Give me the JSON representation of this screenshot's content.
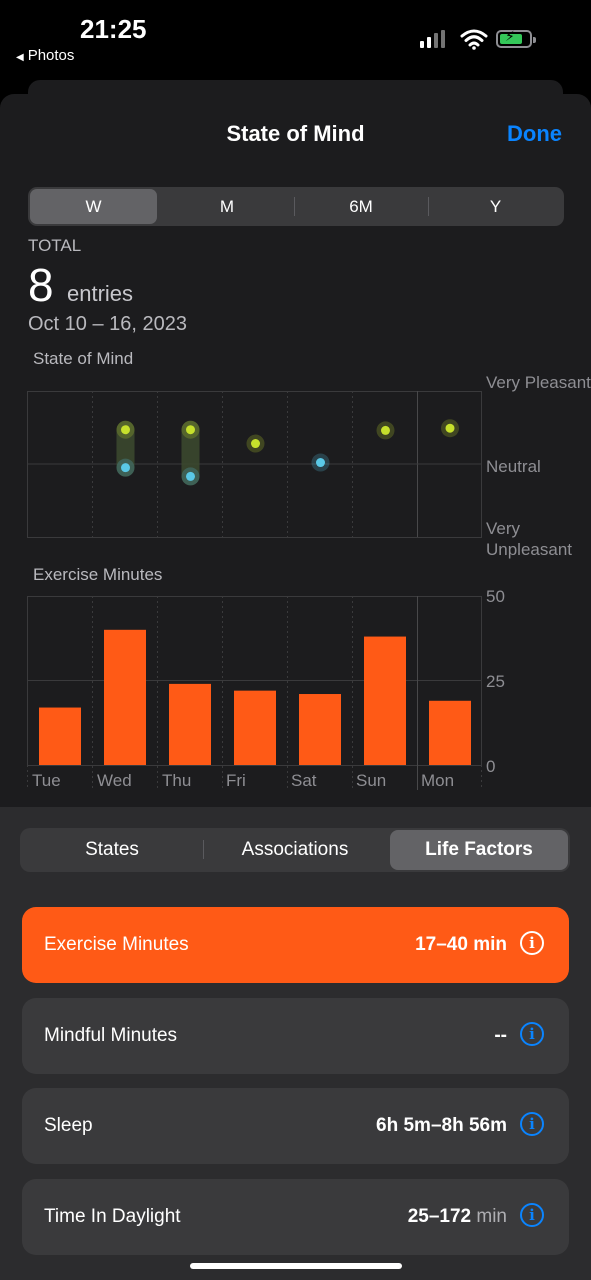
{
  "status": {
    "time": "21:25",
    "back_label": "Photos"
  },
  "header": {
    "title": "State of Mind",
    "done_label": "Done"
  },
  "periods": [
    {
      "label": "W",
      "selected": true
    },
    {
      "label": "M",
      "selected": false
    },
    {
      "label": "6M",
      "selected": false
    },
    {
      "label": "Y",
      "selected": false
    }
  ],
  "summary": {
    "label": "TOTAL",
    "count": "8",
    "unit": "entries",
    "range": "Oct 10 – 16, 2023"
  },
  "colors": {
    "accent": "#0a84ff",
    "exercise": "#ff5a16",
    "pleasant": "#c6e02c",
    "neutral": "#5ac8e6"
  },
  "chart_data": [
    {
      "type": "scatter",
      "title": "State of Mind",
      "x": [
        "Tue",
        "Wed",
        "Thu",
        "Fri",
        "Sat",
        "Sun",
        "Mon"
      ],
      "y_axis_labels": [
        "Very Pleasant",
        "Neutral",
        "Very Unpleasant"
      ],
      "ylim": [
        -1,
        1
      ],
      "points": [
        {
          "day": "Wed",
          "values": [
            0.47,
            -0.05
          ]
        },
        {
          "day": "Thu",
          "values": [
            0.47,
            -0.17
          ]
        },
        {
          "day": "Fri",
          "values": [
            0.28
          ]
        },
        {
          "day": "Sat",
          "values": [
            0.02
          ]
        },
        {
          "day": "Sun",
          "values": [
            0.46
          ]
        },
        {
          "day": "Mon",
          "values": [
            0.49
          ]
        }
      ]
    },
    {
      "type": "bar",
      "title": "Exercise Minutes",
      "categories": [
        "Tue",
        "Wed",
        "Thu",
        "Fri",
        "Sat",
        "Sun",
        "Mon"
      ],
      "values": [
        17,
        40,
        24,
        22,
        21,
        38,
        19
      ],
      "ylim": [
        0,
        50
      ],
      "yticks": [
        "50",
        "25",
        "0"
      ],
      "grid": true
    }
  ],
  "factor_tabs": [
    {
      "label": "States",
      "selected": false
    },
    {
      "label": "Associations",
      "selected": false
    },
    {
      "label": "Life Factors",
      "selected": true
    }
  ],
  "factors": [
    {
      "label": "Exercise Minutes",
      "value": "17–40 min",
      "unit": "",
      "active": true
    },
    {
      "label": "Mindful Minutes",
      "value": "--",
      "unit": "",
      "active": false
    },
    {
      "label": "Sleep",
      "value": "6h 5m–8h 56m",
      "unit": "",
      "active": false
    },
    {
      "label": "Time In Daylight",
      "value": "25–172",
      "unit": "min",
      "active": false
    }
  ]
}
